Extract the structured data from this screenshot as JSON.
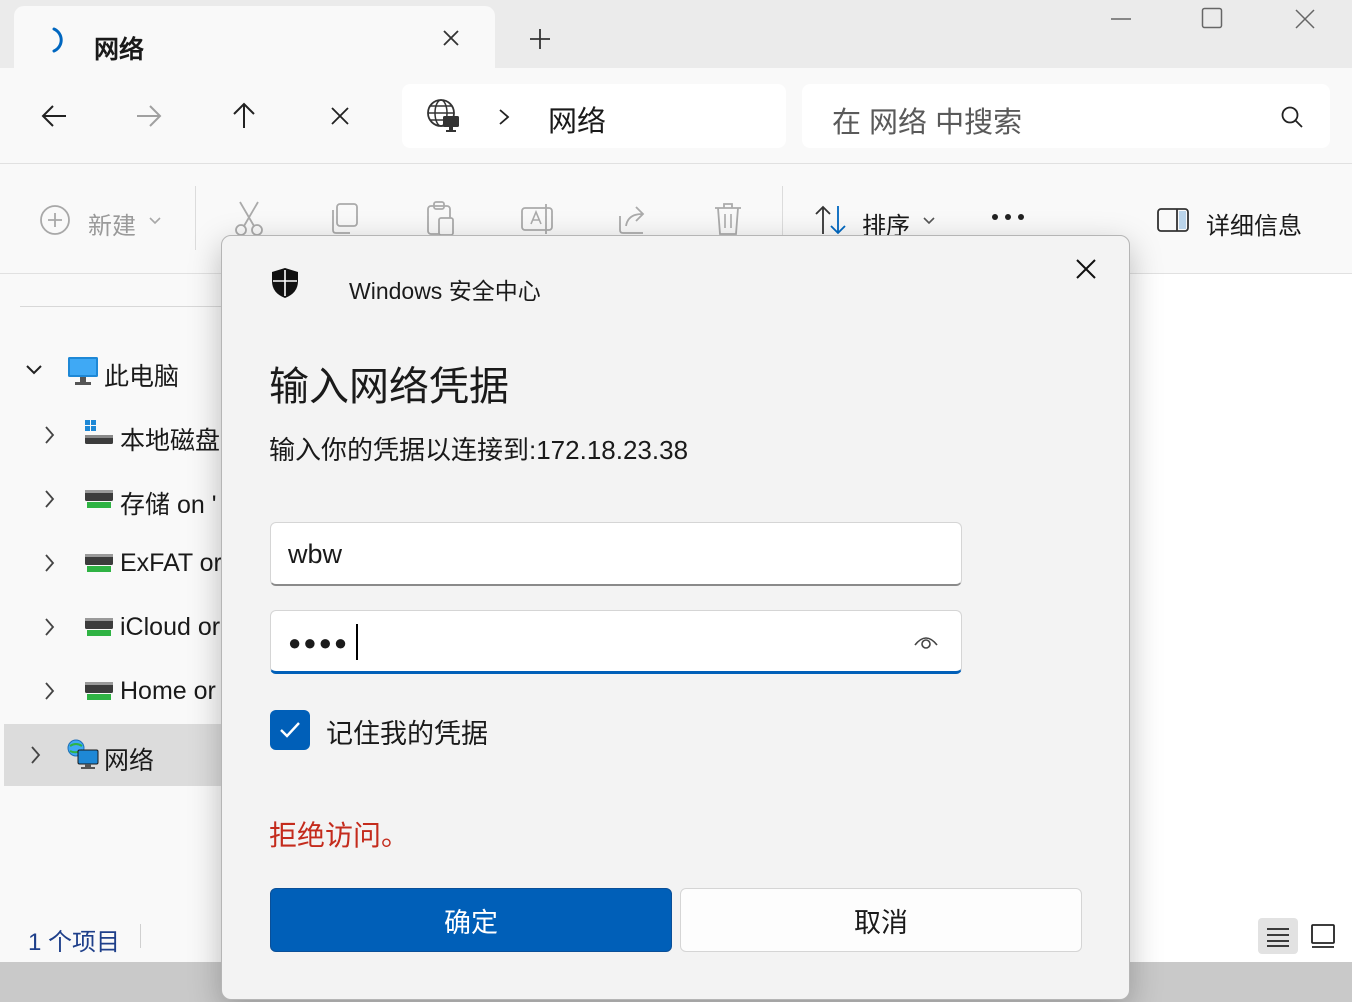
{
  "explorer": {
    "tab_title": "网络",
    "address_location": "网络",
    "search_placeholder": "在 网络 中搜索",
    "toolbar": {
      "new_label": "新建",
      "sort_label": "排序",
      "details_label": "详细信息"
    },
    "tree": {
      "this_pc": "此电脑",
      "items": [
        "本地磁盘",
        "存储 on '",
        "ExFAT or",
        "iCloud or",
        "Home or"
      ],
      "network": "网络"
    },
    "status_count": "1 个项目"
  },
  "dialog": {
    "source": "Windows 安全中心",
    "title": "输入网络凭据",
    "message": "输入你的凭据以连接到:172.18.23.38",
    "username_value": "wbw",
    "password_mask": "●●●●",
    "remember_label": "记住我的凭据",
    "remember_checked": true,
    "error": "拒绝访问。",
    "ok_label": "确定",
    "cancel_label": "取消"
  },
  "colors": {
    "accent": "#005fb8",
    "error": "#c42b1c"
  }
}
